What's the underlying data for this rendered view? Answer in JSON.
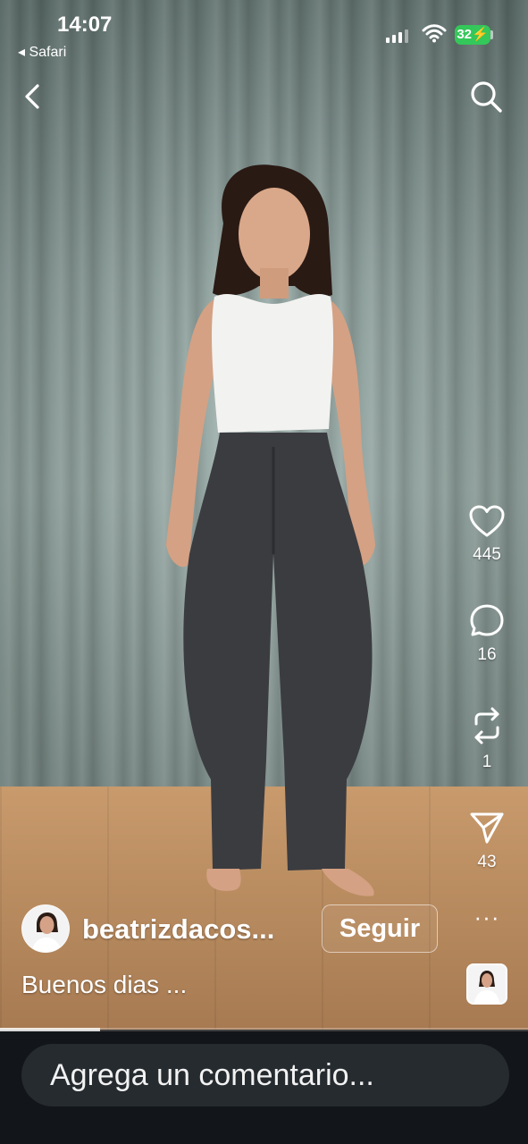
{
  "status_bar": {
    "time": "14:07",
    "back_to_app": "◂ Safari",
    "battery": "32"
  },
  "colors": {
    "battery": "#34c759",
    "comment_bar": "#12161a",
    "comment_input": "#262b30"
  },
  "top_bar": {
    "back_icon": "chevron-left-icon",
    "search_icon": "search-icon"
  },
  "actions": {
    "like": {
      "icon": "heart-icon",
      "count": "445"
    },
    "comment": {
      "icon": "comment-bubble-icon",
      "count": "16"
    },
    "repost": {
      "icon": "repost-icon",
      "count": "1"
    },
    "share": {
      "icon": "send-icon",
      "count": "43"
    },
    "more": "···"
  },
  "post": {
    "username": "beatrizdacos...",
    "follow_label": "Seguir",
    "caption": "Buenos dias ..."
  },
  "video": {
    "progress_fraction": 0.19
  },
  "comment_bar": {
    "placeholder": "Agrega un comentario..."
  }
}
